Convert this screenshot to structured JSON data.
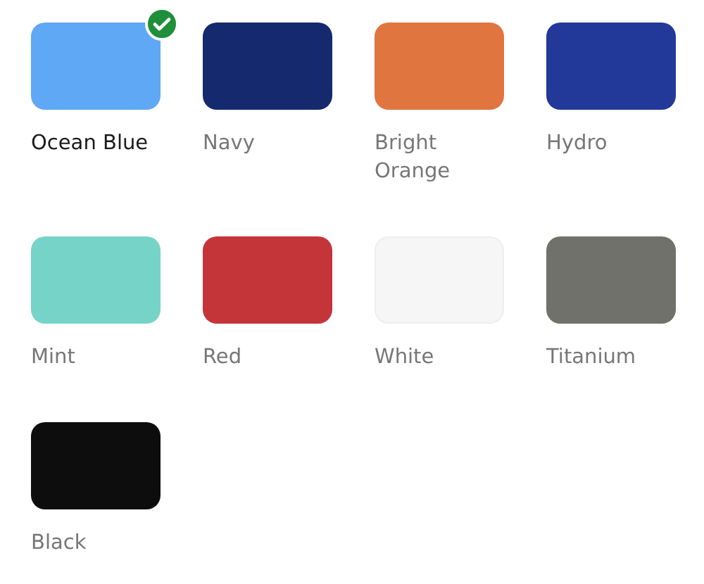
{
  "colors": [
    {
      "name": "Ocean Blue",
      "color": "#5ea8f5",
      "selected": true
    },
    {
      "name": "Navy",
      "color": "#15296e",
      "selected": false
    },
    {
      "name": "Bright Orange",
      "color": "#e07540",
      "selected": false
    },
    {
      "name": "Hydro",
      "color": "#22399a",
      "selected": false
    },
    {
      "name": "Mint",
      "color": "#76d3c7",
      "selected": false
    },
    {
      "name": "Red",
      "color": "#c4353a",
      "selected": false
    },
    {
      "name": "White",
      "color": "#f7f6f7",
      "selected": false
    },
    {
      "name": "Titanium",
      "color": "#70716b",
      "selected": false
    },
    {
      "name": "Black",
      "color": "#0d0d0d",
      "selected": false
    }
  ]
}
